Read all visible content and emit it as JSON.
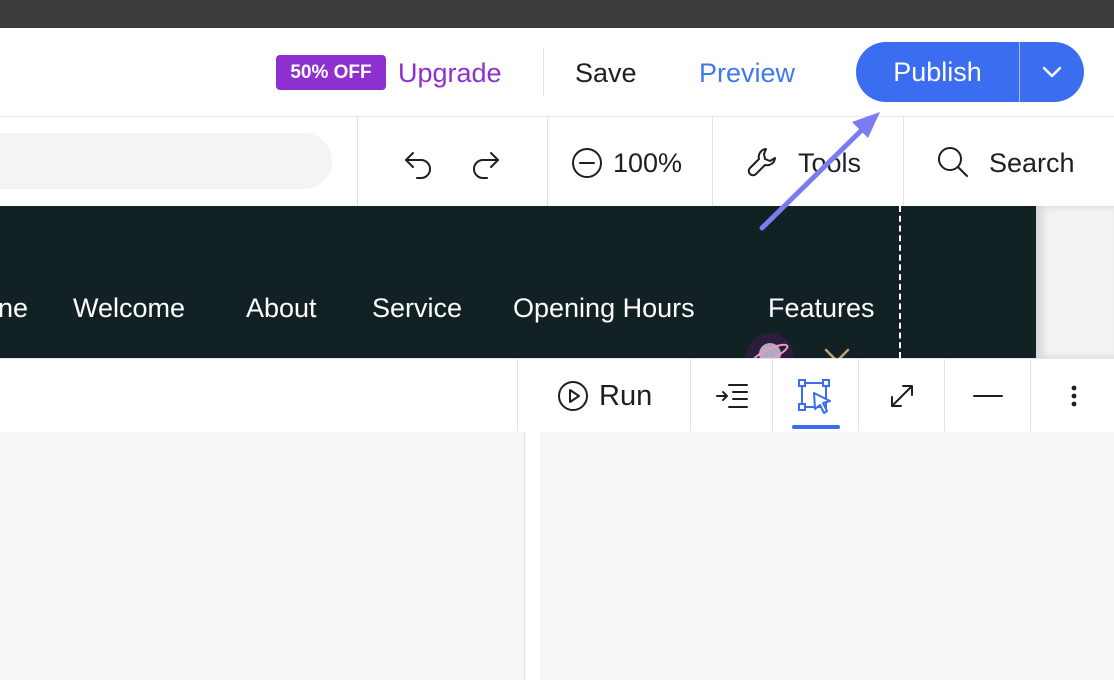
{
  "header": {
    "badge": "50% OFF",
    "upgrade": "Upgrade",
    "save": "Save",
    "preview": "Preview",
    "publish": "Publish"
  },
  "toolbar": {
    "zoom": "100%",
    "tools": "Tools",
    "search": "Search"
  },
  "site_nav": [
    "ne",
    "Welcome",
    "About",
    "Service",
    "Opening Hours",
    "Features"
  ],
  "panel": {
    "run": "Run"
  },
  "colors": {
    "accent": "#3a6df0",
    "upgrade_purple": "#8e2fd0",
    "site_bg": "#122224",
    "annotation_arrow": "#7b7bf2"
  },
  "icons": [
    "chevron-down-icon",
    "undo-icon",
    "redo-icon",
    "zoom-out-icon",
    "wrench-icon",
    "search-icon",
    "play-icon",
    "indent-icon",
    "select-tool-icon",
    "expand-icon",
    "minimize-icon",
    "more-vertical-icon"
  ]
}
